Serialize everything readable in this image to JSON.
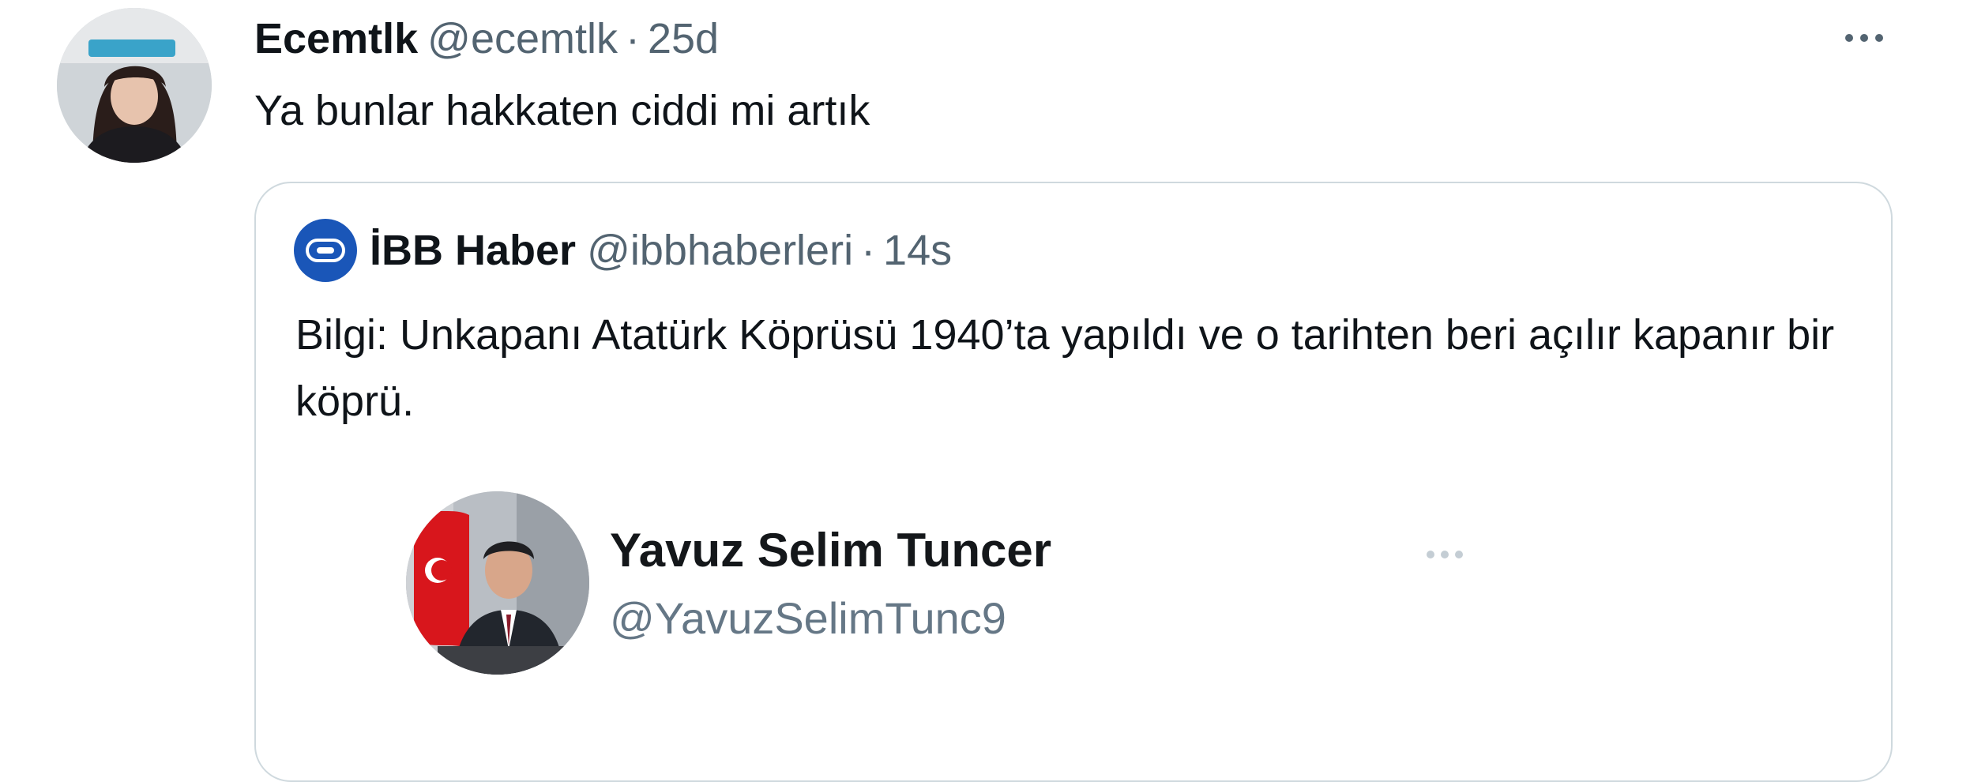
{
  "tweet": {
    "display_name": "Ecemtlk",
    "handle": "@ecemtlk",
    "time": "25d",
    "separator": "·",
    "text": "Ya bunlar hakkaten ciddi mi artık",
    "more_icon": "more-horizontal-icon"
  },
  "quoted_tweet": {
    "display_name": "İBB Haber",
    "handle": "@ibbhaberleri",
    "time": "14s",
    "separator": "·",
    "text": "Bilgi: Unkapanı Atatürk Köprüsü 1940’ta yapıldı ve o tarihten beri açılır kapanır bir köprü.",
    "avatar_icon": "ibb-logo-icon"
  },
  "embedded_screenshot": {
    "display_name": "Yavuz Selim Tuncer",
    "handle": "@YavuzSelimTunc9",
    "more_icon": "more-horizontal-icon"
  },
  "colors": {
    "primary_text": "#0f1419",
    "secondary_text": "#536471",
    "border": "#cfd9de",
    "ibb_blue": "#1a56b8"
  }
}
